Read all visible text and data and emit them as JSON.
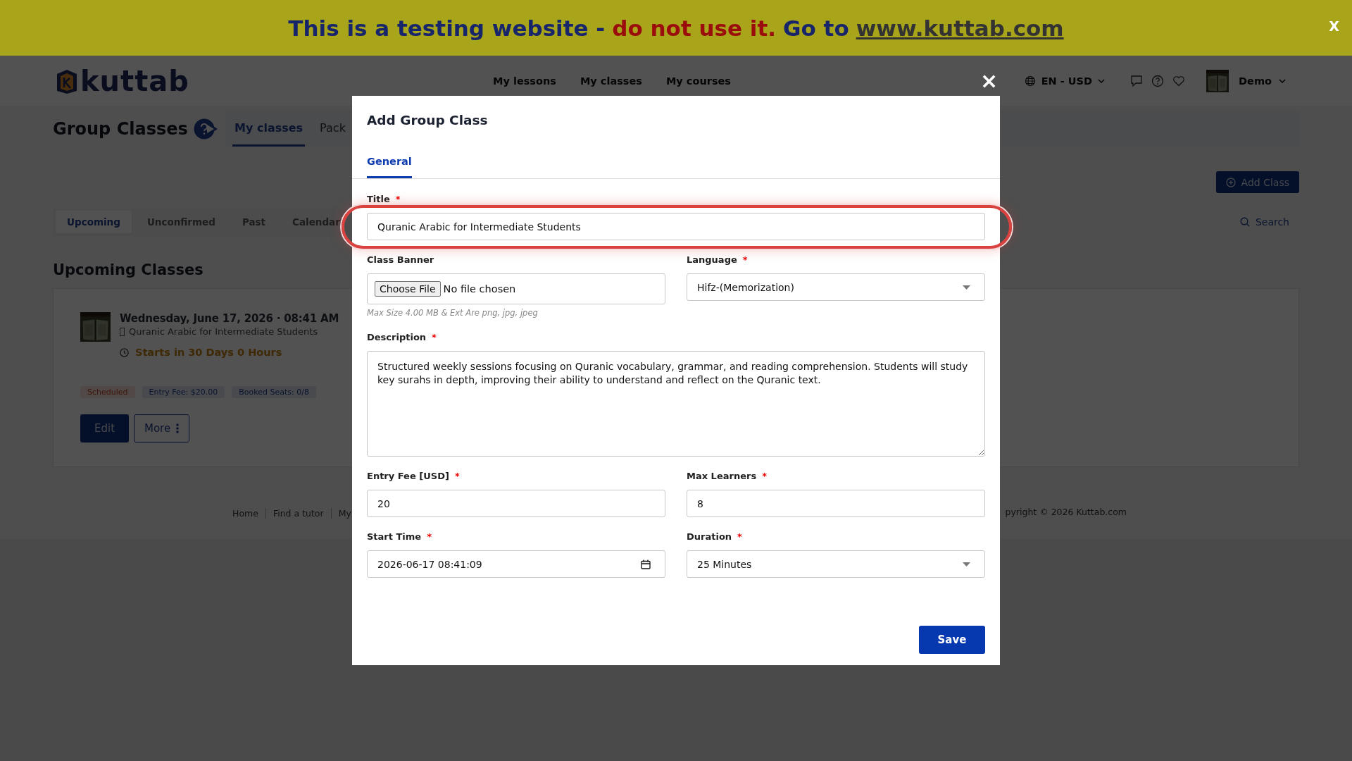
{
  "banner": {
    "parts": [
      {
        "kind": "plain",
        "text": "This is a testing website -"
      },
      {
        "kind": "warning",
        "text": "do not use it."
      },
      {
        "kind": "plain",
        "text": "Go to"
      },
      {
        "kind": "link",
        "text": "www.kuttab.com"
      }
    ],
    "close": "X"
  },
  "header": {
    "logo": "kuttab",
    "nav": [
      "My lessons",
      "My classes",
      "My courses"
    ],
    "locale": "EN - USD",
    "user": "Demo"
  },
  "page": {
    "title": "Group Classes",
    "tabs": [
      {
        "label": "My classes",
        "selected": true
      },
      {
        "label": "Pack",
        "selected": false
      }
    ],
    "add_button": "Add Class",
    "filters": [
      {
        "label": "Upcoming",
        "selected": true
      },
      {
        "label": "Unconfirmed",
        "selected": false
      },
      {
        "label": "Past",
        "selected": false
      },
      {
        "label": "Calendar",
        "selected": false
      }
    ],
    "search_button": "Search",
    "section_title": "Upcoming Classes",
    "class_card": {
      "date": "Wednesday, June 17, 2026 · 08:41 AM",
      "title": "Quranic Arabic for Intermediate Students",
      "countdown": "Starts in 30 Days 0 Hours",
      "badges": [
        {
          "kind": "status",
          "text": "Scheduled"
        },
        {
          "kind": "info",
          "text": "Entry Fee: $20.00"
        },
        {
          "kind": "info",
          "text": "Booked Seats: 0/8"
        }
      ],
      "actions": [
        {
          "kind": "primary",
          "label": "Edit"
        },
        {
          "kind": "outline",
          "label": "More"
        }
      ]
    },
    "footer": {
      "links": [
        "Home",
        "Find a tutor",
        "My"
      ],
      "copyright": "pyright © 2026 Kuttab.com"
    }
  },
  "modal": {
    "close": "×",
    "title": "Add Group Class",
    "tabs": [
      {
        "label": "General",
        "selected": true
      }
    ],
    "rows": [
      [
        {
          "kind": "text",
          "label": "Title",
          "required_mark": "*",
          "value": "Quranic Arabic for Intermediate Students",
          "highlighted": true
        }
      ],
      [
        {
          "kind": "file",
          "label": "Class Banner",
          "button_label": "Choose File",
          "status": "No file chosen",
          "hint": "Max Size 4.00 MB & Ext Are png, jpg, jpeg",
          "highlighted": false
        },
        {
          "kind": "select",
          "label": "Language",
          "required_mark": "*",
          "value": "Hifz-(Memorization)",
          "highlighted": false
        }
      ],
      [
        {
          "kind": "textarea",
          "label": "Description",
          "required_mark": "*",
          "value": "Structured weekly sessions focusing on Quranic vocabulary, grammar, and reading comprehension. Students will study key surahs in depth, improving their ability to understand and reflect on the Quranic text.",
          "highlighted": false
        }
      ],
      [
        {
          "kind": "text",
          "label": "Entry Fee [USD]",
          "required_mark": "*",
          "value": "20",
          "highlighted": false
        },
        {
          "kind": "text",
          "label": "Max Learners",
          "required_mark": "*",
          "value": "8",
          "highlighted": false
        }
      ],
      [
        {
          "kind": "datetime",
          "label": "Start Time",
          "required_mark": "*",
          "value": "2026-06-17 08:41:09",
          "highlighted": false
        },
        {
          "kind": "select",
          "label": "Duration",
          "required_mark": "*",
          "value": "25 Minutes",
          "highlighted": false
        }
      ]
    ],
    "save_button": "Save"
  }
}
